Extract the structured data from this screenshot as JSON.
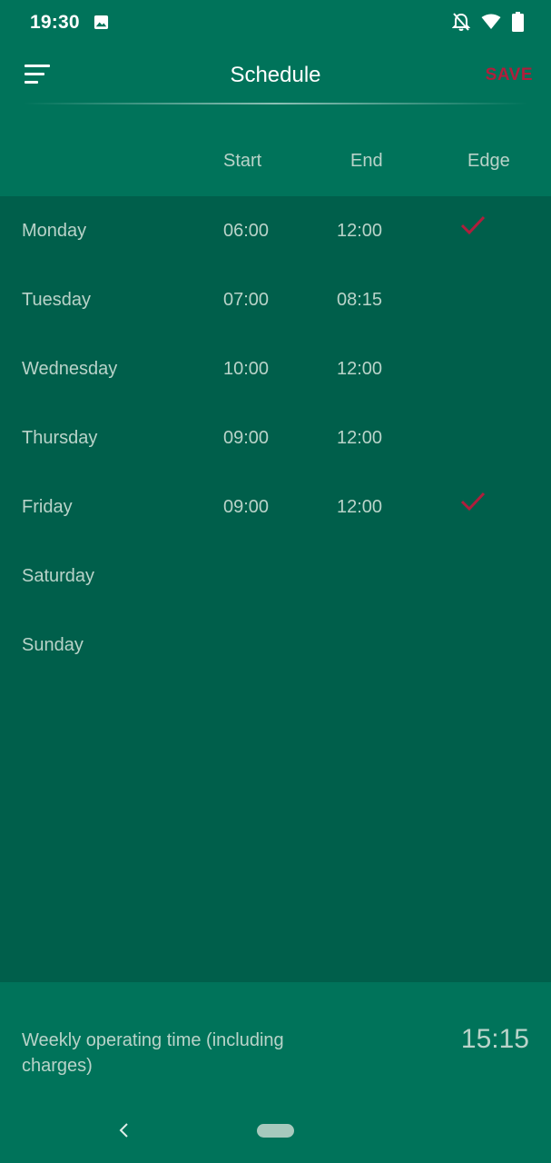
{
  "status_bar": {
    "time": "19:30",
    "icons": [
      "gallery-icon",
      "bell-off-icon",
      "wifi-icon",
      "battery-icon"
    ]
  },
  "header": {
    "title": "Schedule",
    "save_label": "SAVE",
    "menu_icon": "menu-icon"
  },
  "columns": {
    "start": "Start",
    "end": "End",
    "edge": "Edge"
  },
  "schedule": [
    {
      "day": "Monday",
      "start": "06:00",
      "end": "12:00",
      "edge": true
    },
    {
      "day": "Tuesday",
      "start": "07:00",
      "end": "08:15",
      "edge": false
    },
    {
      "day": "Wednesday",
      "start": "10:00",
      "end": "12:00",
      "edge": false
    },
    {
      "day": "Thursday",
      "start": "09:00",
      "end": "12:00",
      "edge": false
    },
    {
      "day": "Friday",
      "start": "09:00",
      "end": "12:00",
      "edge": true
    },
    {
      "day": "Saturday",
      "start": "",
      "end": "",
      "edge": false
    },
    {
      "day": "Sunday",
      "start": "",
      "end": "",
      "edge": false
    }
  ],
  "footer": {
    "label": "Weekly operating time (including charges)",
    "value": "15:15"
  },
  "colors": {
    "primary": "#00735a",
    "background": "#005f4b",
    "text": "#b9d3c9",
    "accent": "#b01e3c"
  }
}
